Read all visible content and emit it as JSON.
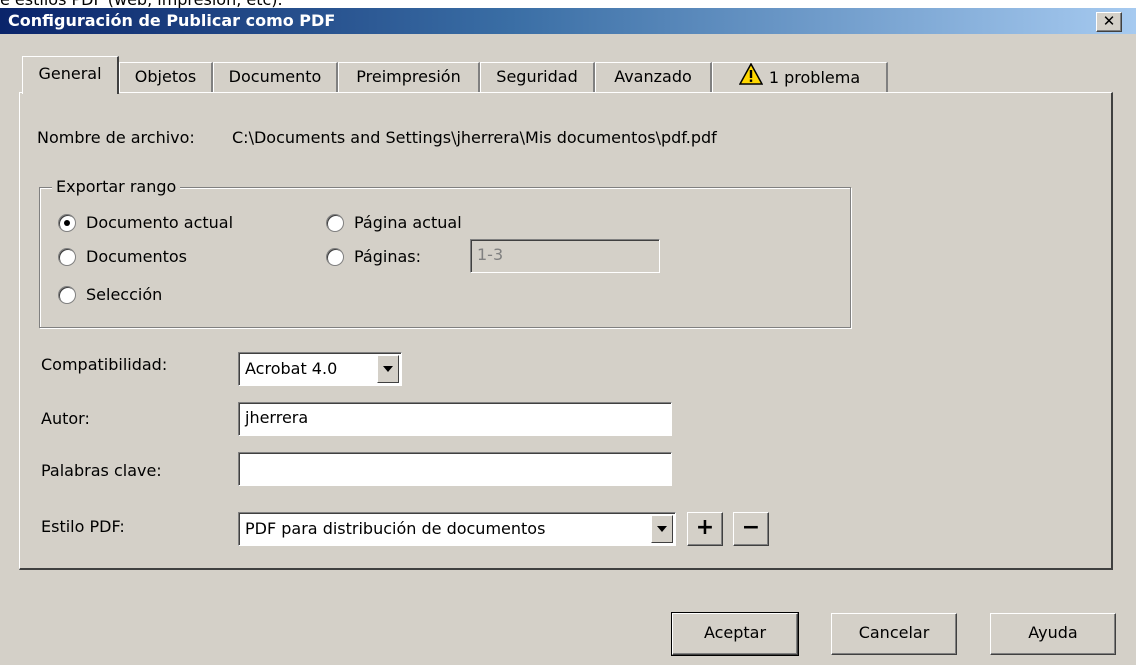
{
  "top_snippet": "e estilos PDF (web, impresión, etc).",
  "window": {
    "title": "Configuración de Publicar como PDF",
    "close_glyph": "✕"
  },
  "tabs": [
    {
      "label": "General",
      "active": true
    },
    {
      "label": "Objetos",
      "active": false
    },
    {
      "label": "Documento",
      "active": false
    },
    {
      "label": "Preimpresión",
      "active": false
    },
    {
      "label": "Seguridad",
      "active": false
    },
    {
      "label": "Avanzado",
      "active": false
    },
    {
      "label": "1 problema",
      "active": false,
      "icon": "warning-icon"
    }
  ],
  "general": {
    "filename_label": "Nombre de archivo:",
    "filename_value": "C:\\Documents and Settings\\jherrera\\Mis documentos\\pdf.pdf",
    "export_range": {
      "legend": "Exportar rango",
      "options": [
        {
          "label": "Documento actual",
          "checked": true
        },
        {
          "label": "Página actual",
          "checked": false
        },
        {
          "label": "Documentos",
          "checked": false
        },
        {
          "label": "Páginas:",
          "checked": false
        },
        {
          "label": "Selección",
          "checked": false
        }
      ],
      "pages_value": "1-3"
    },
    "compat_label": "Compatibilidad:",
    "compat_value": "Acrobat 4.0",
    "author_label": "Autor:",
    "author_value": "jherrera",
    "keywords_label": "Palabras clave:",
    "keywords_value": "",
    "style_label": "Estilo PDF:",
    "style_value": "PDF para distribución de documentos",
    "add_label": "+",
    "remove_label": "−"
  },
  "buttons": {
    "ok": "Aceptar",
    "cancel": "Cancelar",
    "help": "Ayuda"
  },
  "colors": {
    "face": "#d4d0c8",
    "title_start": "#0a246a",
    "title_end": "#a6caf0",
    "warning": "#ffd700"
  }
}
